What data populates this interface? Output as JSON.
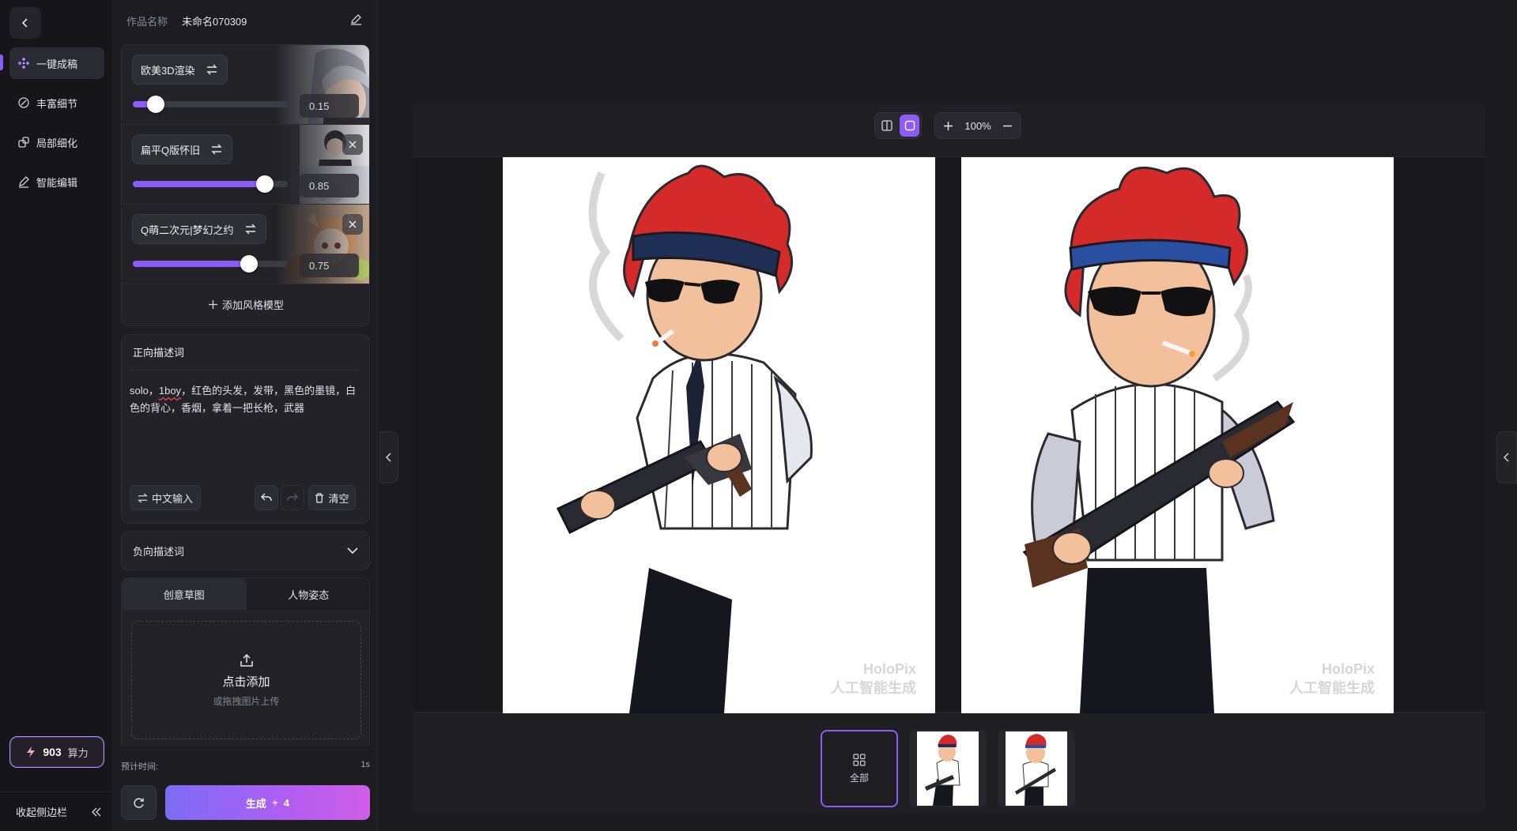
{
  "nav": {
    "items": [
      {
        "label": "一键成稿",
        "icon": "sparkle-dots-icon",
        "active": true
      },
      {
        "label": "丰富细节",
        "icon": "detail-brush-icon",
        "active": false
      },
      {
        "label": "局部细化",
        "icon": "region-refine-icon",
        "active": false
      },
      {
        "label": "智能编辑",
        "icon": "pen-edit-icon",
        "active": false
      }
    ],
    "credits": {
      "value": "903",
      "unit": "算力"
    },
    "collapse_label": "收起侧边栏"
  },
  "work": {
    "label": "作品名称",
    "name": "未命名070309"
  },
  "styles": [
    {
      "name": "欧美3D渲染",
      "value": 0.15,
      "value_text": "0.15",
      "removable": false
    },
    {
      "name": "扁平Q版怀旧",
      "value": 0.85,
      "value_text": "0.85",
      "removable": true
    },
    {
      "name": "Q萌二次元|梦幻之约",
      "value": 0.75,
      "value_text": "0.75",
      "removable": true
    }
  ],
  "add_style_label": "添加风格模型",
  "positive_prompt": {
    "title": "正向描述词",
    "text_before": "solo，",
    "text_flag": "1boy",
    "text_after": "，红色的头发，发带，黑色的墨镜，白色的背心，香烟，拿着一把长枪，武器",
    "cn_input_label": "中文输入",
    "clear_label": "清空"
  },
  "negative_prompt": {
    "title": "负向描述词"
  },
  "reference_tabs": [
    {
      "label": "创意草图",
      "active": true
    },
    {
      "label": "人物姿态",
      "active": false
    }
  ],
  "upload": {
    "title": "点击添加",
    "subtitle": "或拖拽图片上传"
  },
  "eta": {
    "label": "预计时间:",
    "value": "1s"
  },
  "generate": {
    "label": "生成",
    "cost": "4"
  },
  "canvas": {
    "zoom": "100%",
    "watermark_line1": "HoloPix",
    "watermark_line2": "人工智能生成",
    "thumb_all_label": "全部"
  },
  "colors": {
    "accent": "#8b5cf6",
    "hair": "#d42a2a",
    "headband": "#1f3f8a"
  }
}
